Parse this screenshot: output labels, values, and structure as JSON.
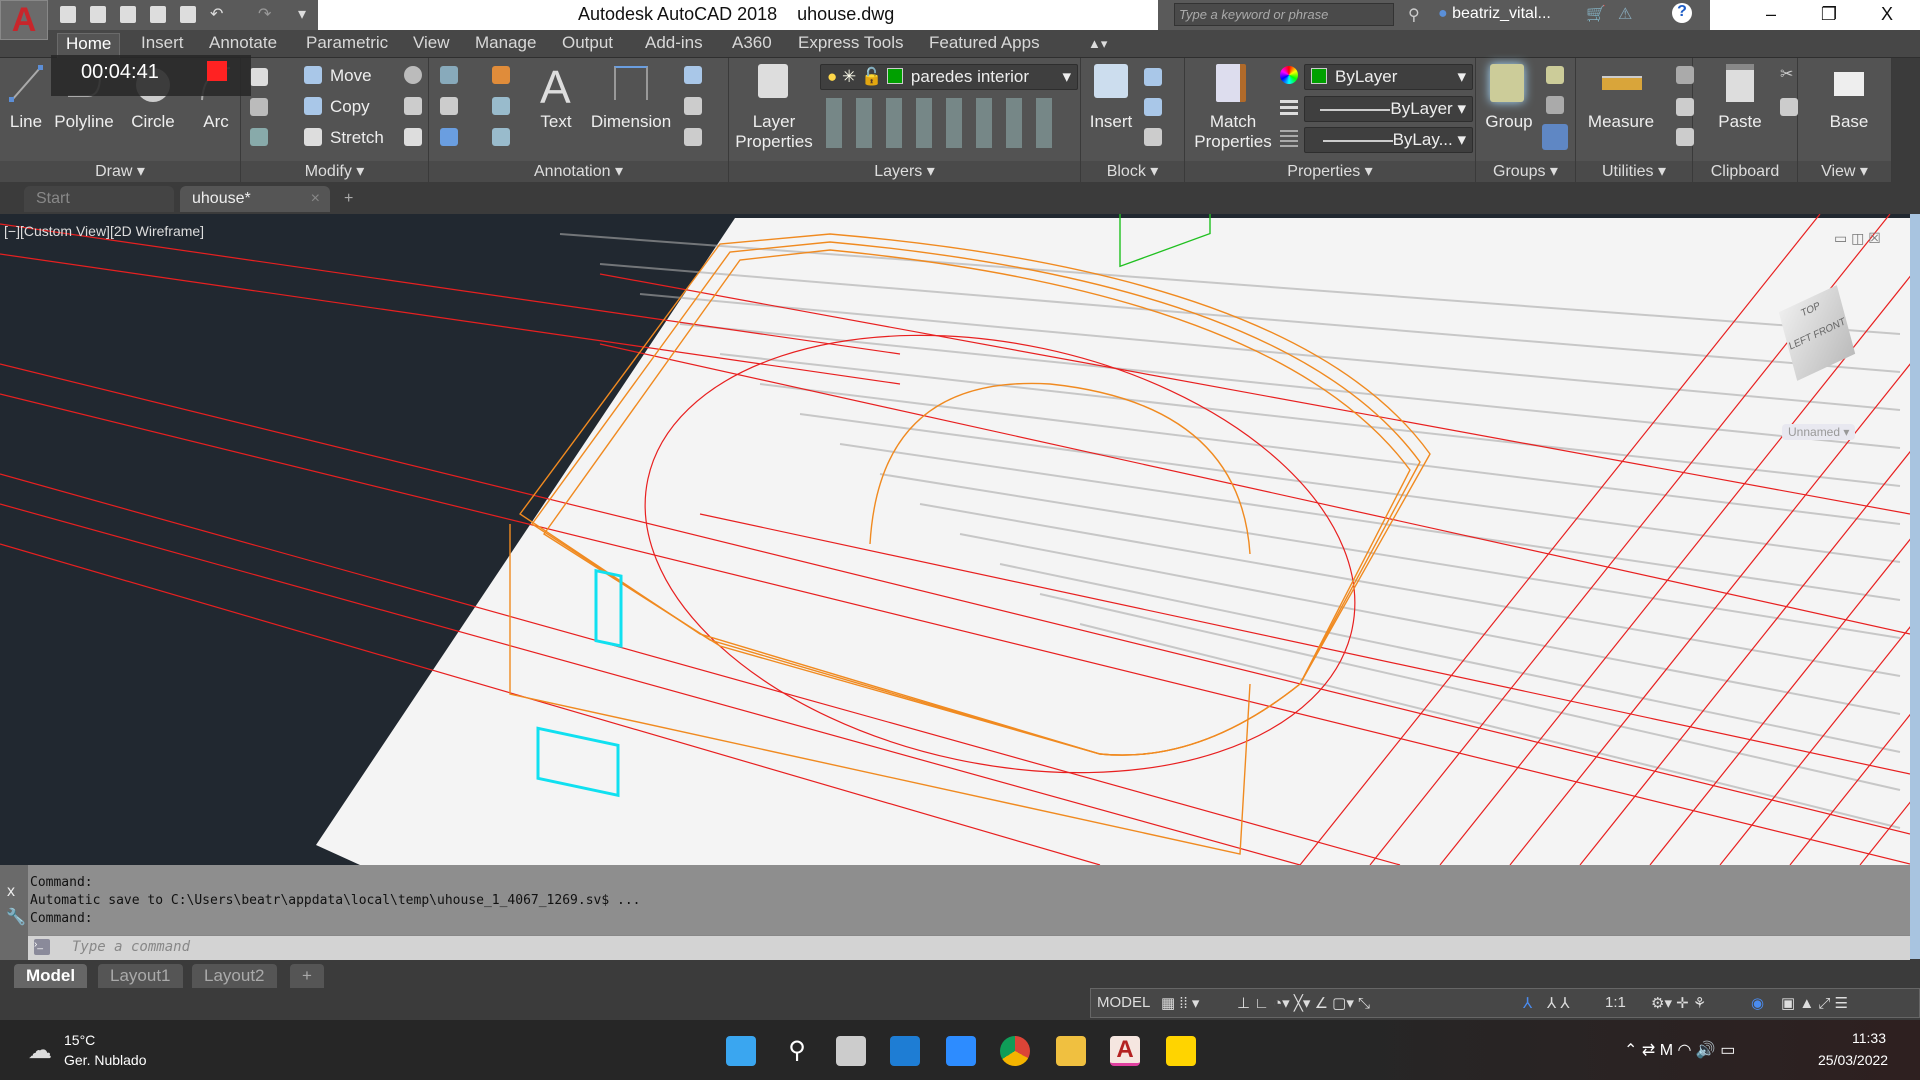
{
  "titlebar": {
    "app_title": "Autodesk AutoCAD 2018",
    "file_name": "uhouse.dwg",
    "search_placeholder": "Type a keyword or phrase",
    "user": "beatriz_vital...",
    "app_logo": "A",
    "min": "–",
    "max": "❐",
    "close": "X"
  },
  "recording": {
    "time": "00:04:41"
  },
  "ribbon_tabs": [
    "Home",
    "Insert",
    "Annotate",
    "Parametric",
    "View",
    "Manage",
    "Output",
    "Add-ins",
    "A360",
    "Express Tools",
    "Featured Apps"
  ],
  "panels": {
    "draw": {
      "title": "Draw ▾",
      "buttons": [
        "Line",
        "Polyline",
        "Circle",
        "Arc"
      ]
    },
    "modify": {
      "title": "Modify ▾",
      "buttons": [
        "Move",
        "Copy",
        "Stretch"
      ]
    },
    "annotation": {
      "title": "Annotation ▾",
      "buttons": [
        "Text",
        "Dimension"
      ]
    },
    "layers": {
      "title": "Layers ▾",
      "button": "Layer\nProperties",
      "current_layer": "paredes  interior"
    },
    "block": {
      "title": "Block ▾",
      "button": "Insert"
    },
    "properties": {
      "title": "Properties ▾",
      "button": "Match\nProperties",
      "color": "ByLayer",
      "linetype": "ByLayer",
      "lineweight": "ByLay...",
      "layer_color": "#00a000"
    },
    "groups": {
      "title": "Groups ▾",
      "button": "Group"
    },
    "utilities": {
      "title": "Utilities ▾",
      "button": "Measure"
    },
    "clipboard": {
      "title": "Clipboard",
      "button": "Paste"
    },
    "view": {
      "title": "View ▾",
      "button": "Base"
    }
  },
  "file_tabs": [
    {
      "label": "Start"
    },
    {
      "label": "uhouse*",
      "close": "×"
    }
  ],
  "file_tab_add": "+",
  "viewport": {
    "label": "[−][Custom View][2D Wireframe]",
    "viewcube": {
      "left": "LEFT",
      "front": "FRONT",
      "top": "TOP",
      "named_view": "Unnamed"
    }
  },
  "command": {
    "history": [
      "Command:",
      "Automatic save to C:\\Users\\beatr\\appdata\\local\\temp\\uhouse_1_4067_1269.sv$ ...",
      "Command:"
    ],
    "placeholder": "Type a command"
  },
  "layout_tabs": [
    "Model",
    "Layout1",
    "Layout2"
  ],
  "layout_tab_add": "+",
  "statusbar": {
    "model": "MODEL",
    "scale": "1:1"
  },
  "taskbar": {
    "temperature": "15°C",
    "weather": "Ger. Nublado",
    "time": "11:33",
    "date": "25/03/2022"
  }
}
